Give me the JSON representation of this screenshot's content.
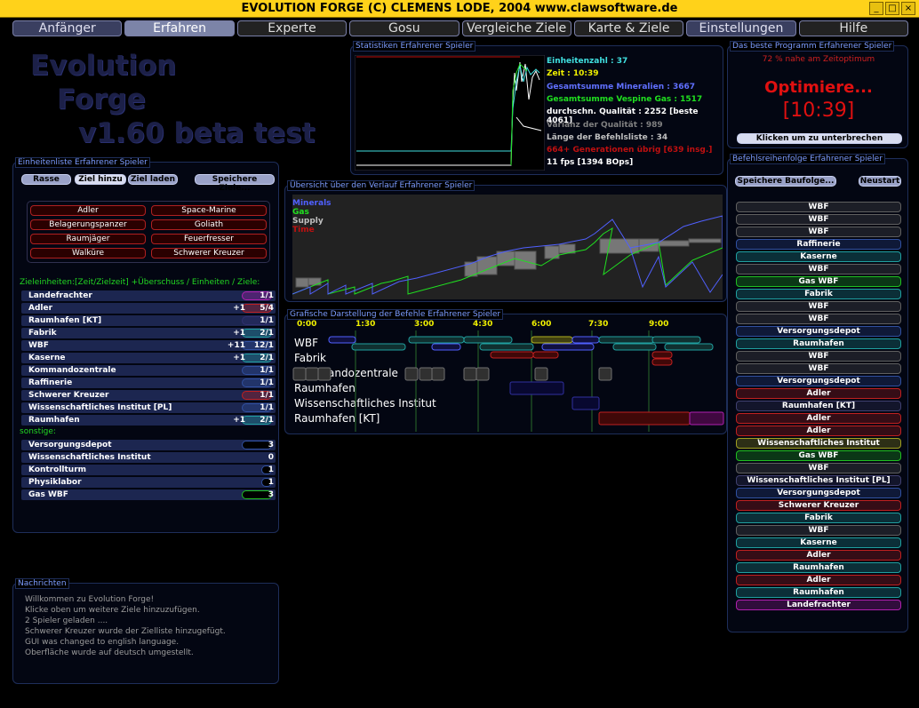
{
  "window": {
    "title": "EVOLUTION FORGE (C) CLEMENS LODE, 2004 www.clawsoftware.de",
    "btn_minimize": "_",
    "btn_maximize": "□",
    "btn_close": "×"
  },
  "tabs": [
    "Anfänger",
    "Erfahren",
    "Experte",
    "Gosu",
    "Vergleiche Ziele",
    "Karte & Ziele",
    "Einstellungen",
    "Hilfe"
  ],
  "logo": {
    "line1": "Evolution",
    "line2": "Forge",
    "line3": "v1.60 beta test"
  },
  "stats_panel": {
    "title": "Statistiken Erfahrener Spieler",
    "lines": [
      {
        "text": "Einheitenzahl : 37",
        "color": "#40e0e0"
      },
      {
        "text": "Zeit : 10:39",
        "color": "#f0f000"
      },
      {
        "text": "Gesamtsumme Mineralien : 3667",
        "color": "#6070ff"
      },
      {
        "text": "Gesamtsumme Vespine Gas : 1517",
        "color": "#20e020"
      },
      {
        "text": "durchschn. Qualität : 2252 [beste 4061]",
        "color": "#ffffff"
      },
      {
        "text": "Varianz der Qualität : 989",
        "color": "#808080"
      },
      {
        "text": "Länge der Befehlsliste : 34",
        "color": "#c0c0c0"
      },
      {
        "text": "664+ Generationen übrig [639 insg.]",
        "color": "#c01010"
      },
      {
        "text": "11 fps [1394 BOps]",
        "color": "#ffffff"
      }
    ]
  },
  "best_panel": {
    "title": "Das beste Programm Erfahrener Spieler",
    "percent": "72 % nahe am Zeitoptimum",
    "status": "Optimiere...",
    "time": "[10:39]",
    "interrupt_button": "Klicken um zu unterbrechen"
  },
  "unit_panel": {
    "title": "Einheitenliste Erfahrener Spieler",
    "buttons": [
      "Rasse",
      "Ziel hinzu",
      "Ziel laden",
      "Speichere Ziele..."
    ],
    "goals": [
      "Adler",
      "Space-Marine",
      "Belagerungspanzer",
      "Goliath",
      "Raumjäger",
      "Feuerfresser",
      "Walküre",
      "Schwerer Kreuzer"
    ],
    "goal_header": "Zieleinheiten:[Zeit/Zielzeit]  +Überschuss / Einheiten / Ziele:",
    "goal_units": [
      {
        "name": "Landefrachter",
        "extra": "",
        "count": "1/1",
        "color": "#b020b0",
        "fill": 0.35
      },
      {
        "name": "Adler",
        "extra": "+1",
        "count": "5/4",
        "color": "#c02020",
        "fill": 0.35
      },
      {
        "name": "Raumhafen [KT]",
        "extra": "",
        "count": "1/1",
        "color": "#303070",
        "fill": 0.35
      },
      {
        "name": "Fabrik",
        "extra": "+1",
        "count": "2/1",
        "color": "#20a0a0",
        "fill": 0.35
      },
      {
        "name": "WBF",
        "extra": "+11",
        "count": "12/1",
        "color": "#3050a0",
        "fill": 0.35
      },
      {
        "name": "Kaserne",
        "extra": "+1",
        "count": "2/1",
        "color": "#20a0a0",
        "fill": 0.35
      },
      {
        "name": "Kommandozentrale",
        "extra": "",
        "count": "1/1",
        "color": "#3050a0",
        "fill": 0.35
      },
      {
        "name": "Raffinerie",
        "extra": "",
        "count": "1/1",
        "color": "#3050a0",
        "fill": 0.35
      },
      {
        "name": "Schwerer Kreuzer",
        "extra": "",
        "count": "1/1",
        "color": "#c02020",
        "fill": 0.35
      },
      {
        "name": "Wissenschaftliches Institut [PL]",
        "extra": "",
        "count": "1/1",
        "color": "#3050a0",
        "fill": 0.35
      },
      {
        "name": "Raumhafen",
        "extra": "+1",
        "count": "2/1",
        "color": "#20a0a0",
        "fill": 0.35
      }
    ],
    "other_header": "sonstige:",
    "other_units": [
      {
        "name": "Versorgungsdepot",
        "count": "3",
        "color": "#3050a0",
        "fill": 0.35
      },
      {
        "name": "Wissenschaftliches Institut",
        "count": "0",
        "color": "#3050a0",
        "fill": 0
      },
      {
        "name": "Kontrollturm",
        "count": "1",
        "color": "#3050a0",
        "fill": 0.12
      },
      {
        "name": "Physiklabor",
        "count": "1",
        "color": "#3050a0",
        "fill": 0.12
      },
      {
        "name": "Gas WBF",
        "count": "3",
        "color": "#20c020",
        "fill": 0.35
      }
    ]
  },
  "messages": {
    "title": "Nachrichten",
    "lines": [
      "Willkommen zu Evolution Forge!",
      "Klicke oben um weitere Ziele hinzuzufügen.",
      "2 Spieler geladen ....",
      "Schwerer Kreuzer wurde der Zielliste hinzugefügt.",
      "GUI was changed to english language.",
      "Oberfläche wurde auf deutsch umgestellt."
    ]
  },
  "overview": {
    "title": "Übersicht über den Verlauf Erfahrener Spieler",
    "legend": [
      {
        "label": "Minerals",
        "color": "#5060ff"
      },
      {
        "label": "Gas",
        "color": "#20e020"
      },
      {
        "label": "Supply",
        "color": "#c0c0c0"
      },
      {
        "label": "Time",
        "color": "#c01010"
      }
    ]
  },
  "timeline": {
    "title": "Grafische Darstellung der Befehle Erfahrener Spieler",
    "times": [
      "0:00",
      "1:30",
      "3:00",
      "4:30",
      "6:00",
      "7:30",
      "9:00"
    ],
    "rows": [
      "WBF",
      "Fabrik",
      "Kommandozentrale",
      "Raumhafen",
      "Wissenschaftliches Institut",
      "Raumhafen [KT]"
    ]
  },
  "order_panel": {
    "title": "Befehlsreihenfolge Erfahrener Spieler",
    "save_button": "Speichere Baufolge...",
    "restart_button": "Neustart",
    "items": [
      {
        "label": "WBF",
        "color": "#606060"
      },
      {
        "label": "WBF",
        "color": "#606060"
      },
      {
        "label": "WBF",
        "color": "#606060"
      },
      {
        "label": "Raffinerie",
        "color": "#3050a0"
      },
      {
        "label": "Kaserne",
        "color": "#20a0a0"
      },
      {
        "label": "WBF",
        "color": "#606060"
      },
      {
        "label": "Gas WBF",
        "color": "#20c020"
      },
      {
        "label": "Fabrik",
        "color": "#20a0a0"
      },
      {
        "label": "WBF",
        "color": "#606060"
      },
      {
        "label": "WBF",
        "color": "#606060"
      },
      {
        "label": "Versorgungsdepot",
        "color": "#3050a0"
      },
      {
        "label": "Raumhafen",
        "color": "#20a0a0"
      },
      {
        "label": "WBF",
        "color": "#606060"
      },
      {
        "label": "WBF",
        "color": "#606060"
      },
      {
        "label": "Versorgungsdepot",
        "color": "#3050a0"
      },
      {
        "label": "Adler",
        "color": "#c02020"
      },
      {
        "label": "Raumhafen [KT]",
        "color": "#404070"
      },
      {
        "label": "Adler",
        "color": "#c02020"
      },
      {
        "label": "Adler",
        "color": "#c02020"
      },
      {
        "label": "Wissenschaftliches Institut",
        "color": "#a0a020"
      },
      {
        "label": "Gas WBF",
        "color": "#20c020"
      },
      {
        "label": "WBF",
        "color": "#606060"
      },
      {
        "label": "Wissenschaftliches Institut [PL]",
        "color": "#404070"
      },
      {
        "label": "Versorgungsdepot",
        "color": "#3050a0"
      },
      {
        "label": "Schwerer Kreuzer",
        "color": "#c02020"
      },
      {
        "label": "Fabrik",
        "color": "#20a0a0"
      },
      {
        "label": "WBF",
        "color": "#606060"
      },
      {
        "label": "Kaserne",
        "color": "#20a0a0"
      },
      {
        "label": "Adler",
        "color": "#c02020"
      },
      {
        "label": "Raumhafen",
        "color": "#20a0a0"
      },
      {
        "label": "Adler",
        "color": "#c02020"
      },
      {
        "label": "Raumhafen",
        "color": "#20a0a0"
      },
      {
        "label": "Landefrachter",
        "color": "#b020b0"
      }
    ]
  }
}
